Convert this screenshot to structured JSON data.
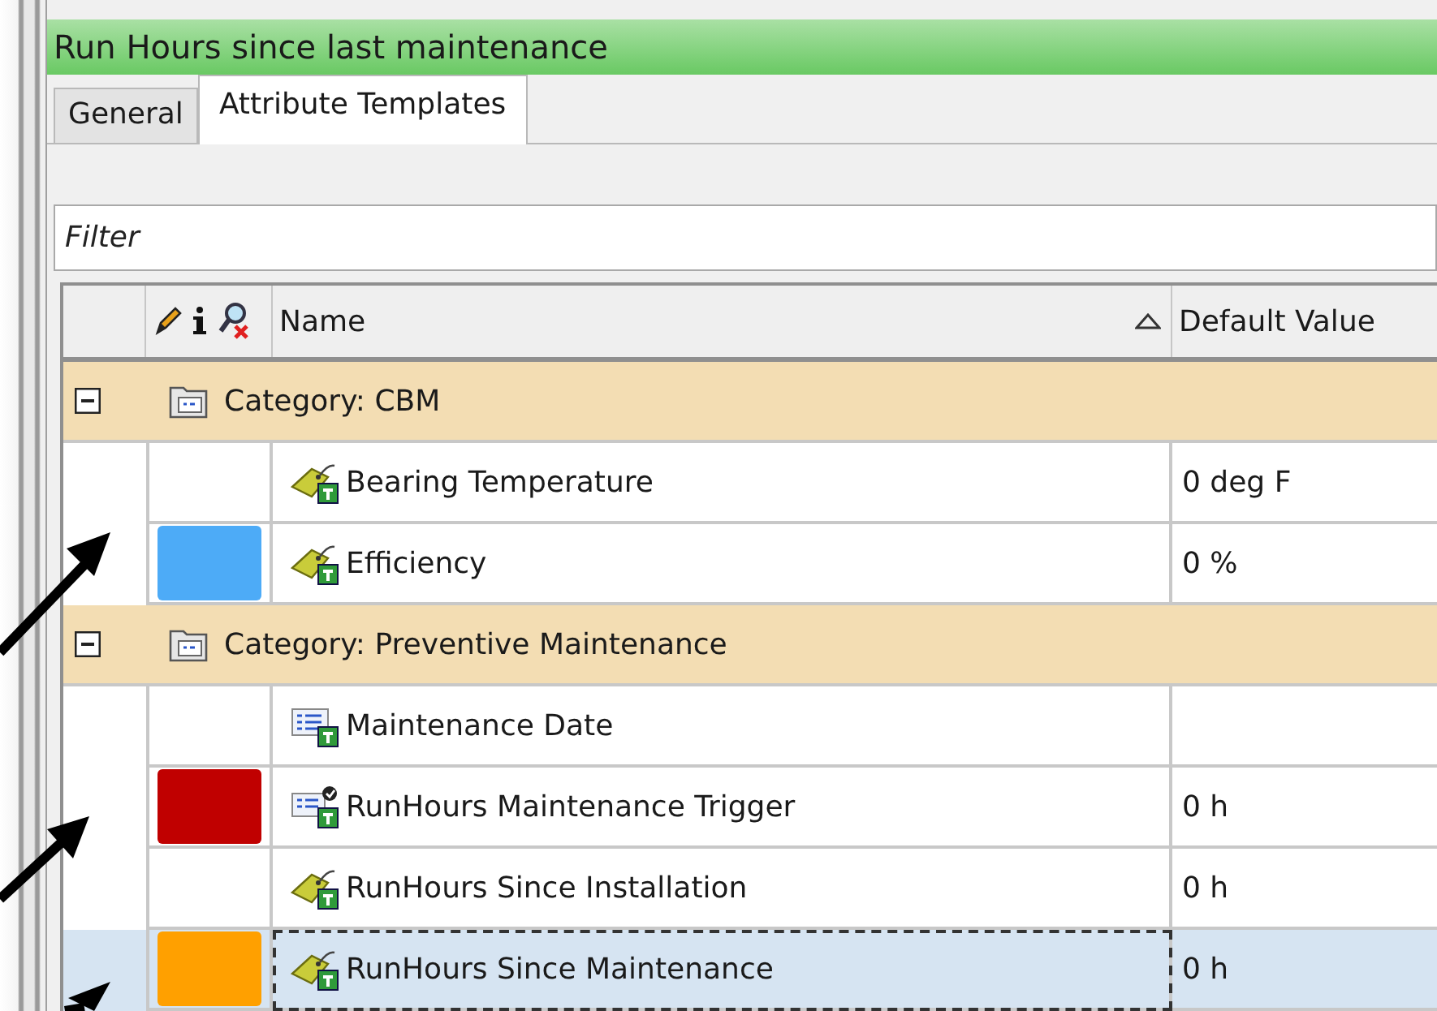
{
  "window": {
    "title": "Run Hours since last maintenance"
  },
  "tabs": [
    {
      "label": "General",
      "selected": false
    },
    {
      "label": "Attribute Templates",
      "selected": true
    }
  ],
  "filter": {
    "placeholder": "Filter"
  },
  "table": {
    "columns": [
      {
        "label": "Name",
        "sort_ascending": true
      },
      {
        "label": "Default Value"
      }
    ],
    "groups": [
      {
        "label": "Category: CBM",
        "expanded": true,
        "items": [
          {
            "kind": "tag",
            "name": "Bearing Temperature",
            "value": "0 deg F",
            "selected": false
          },
          {
            "kind": "tag",
            "name": "Efficiency",
            "value": "0 %",
            "color": "#4dabf7",
            "selected": false
          }
        ]
      },
      {
        "label": "Category: Preventive Maintenance",
        "expanded": true,
        "items": [
          {
            "kind": "list",
            "name": "Maintenance Date",
            "selected": false
          },
          {
            "kind": "list-check",
            "name": "RunHours Maintenance Trigger",
            "value": "0 h",
            "color": "#c00000",
            "selected": false
          },
          {
            "kind": "tag",
            "name": "RunHours Since Installation",
            "value": "0 h",
            "selected": false
          },
          {
            "kind": "tag",
            "name": "RunHours Since Maintenance",
            "value": "0 h",
            "color": "#ffa000",
            "selected": true
          }
        ]
      }
    ]
  }
}
